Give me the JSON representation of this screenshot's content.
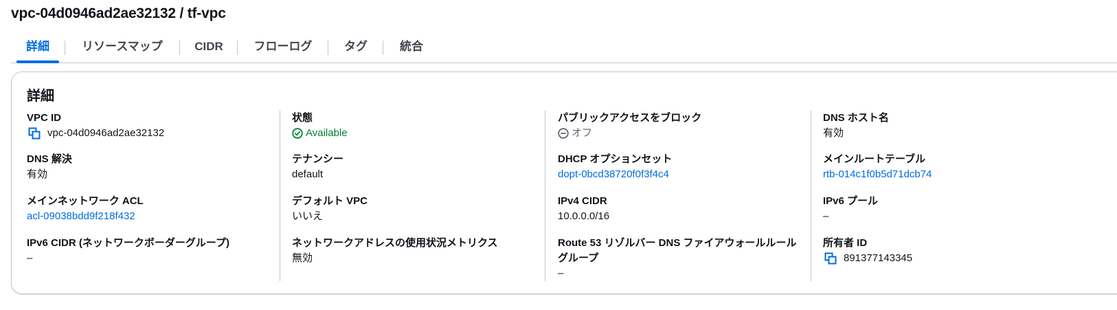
{
  "header": {
    "title": "vpc-04d0946ad2ae32132 / tf-vpc"
  },
  "tabs": [
    {
      "label": "詳細",
      "active": true
    },
    {
      "label": "リソースマップ",
      "active": false
    },
    {
      "label": "CIDR",
      "active": false
    },
    {
      "label": "フローログ",
      "active": false
    },
    {
      "label": "タグ",
      "active": false
    },
    {
      "label": "統合",
      "active": false
    }
  ],
  "details": {
    "title": "詳細",
    "col1": {
      "vpc_id": {
        "label": "VPC ID",
        "value": "vpc-04d0946ad2ae32132"
      },
      "dns_resolution": {
        "label": "DNS 解決",
        "value": "有効"
      },
      "main_network_acl": {
        "label": "メインネットワーク ACL",
        "value": "acl-09038bdd9f218f432"
      },
      "ipv6_cidr_border_group": {
        "label": "IPv6 CIDR (ネットワークボーダーグループ)",
        "value": "–"
      }
    },
    "col2": {
      "state": {
        "label": "状態",
        "value": "Available"
      },
      "tenancy": {
        "label": "テナンシー",
        "value": "default"
      },
      "default_vpc": {
        "label": "デフォルト VPC",
        "value": "いいえ"
      },
      "network_address_usage_metrics": {
        "label": "ネットワークアドレスの使用状況メトリクス",
        "value": "無効"
      }
    },
    "col3": {
      "block_public_access": {
        "label": "パブリックアクセスをブロック",
        "value": "オフ"
      },
      "dhcp_option_set": {
        "label": "DHCP オプションセット",
        "value": "dopt-0bcd38720f0f3f4c4"
      },
      "ipv4_cidr": {
        "label": "IPv4 CIDR",
        "value": "10.0.0.0/16"
      },
      "route53_resolver_firewall": {
        "label_line1": "Route 53 リゾルバー DNS ファイアウォールルール",
        "label_line2": "グループ",
        "value": "–"
      }
    },
    "col4": {
      "dns_hostnames": {
        "label": "DNS ホスト名",
        "value": "有効"
      },
      "main_route_table": {
        "label": "メインルートテーブル",
        "value": "rtb-014c1f0b5d71dcb74"
      },
      "ipv6_pool": {
        "label": "IPv6 プール",
        "value": "–"
      },
      "owner_id": {
        "label": "所有者 ID",
        "value": "891377143345"
      }
    }
  },
  "colors": {
    "link": "#006ce0",
    "success": "#00802f",
    "muted": "#656871",
    "text": "#0f141a"
  }
}
